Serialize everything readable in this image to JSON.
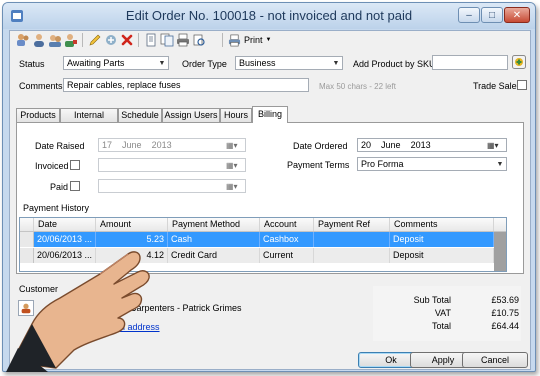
{
  "window": {
    "title": "Edit Order No. 100018 - not invoiced and not paid",
    "buttons": [
      "–",
      "□",
      "✕"
    ]
  },
  "toolbar": {
    "print_label": "Print",
    "icons": [
      "users-icon",
      "user-icon",
      "customers-icon",
      "edit-user-icon",
      "pencil-icon",
      "open-icon",
      "delete-icon",
      "document-icon",
      "copy-icon",
      "printer-icon",
      "print-icon"
    ]
  },
  "form": {
    "status_label": "Status",
    "status_value": "Awaiting Parts",
    "order_type_label": "Order Type",
    "order_type_value": "Business",
    "add_sku_label": "Add Product by SKU",
    "add_sku_value": "",
    "comments_label": "Comments",
    "comments_value": "Repair cables, replace fuses",
    "comments_hint": "Max 50 chars - 22 left",
    "trade_sale_label": "Trade Sale"
  },
  "tabs": [
    {
      "label": "Products"
    },
    {
      "label": "Internal Notes"
    },
    {
      "label": "Schedule"
    },
    {
      "label": "Assign Users"
    },
    {
      "label": "Hours"
    },
    {
      "label": "Billing"
    }
  ],
  "billing": {
    "date_raised_label": "Date Raised",
    "date_raised_day": "17",
    "date_raised_month": "June",
    "date_raised_year": "2013",
    "invoiced_label": "Invoiced",
    "paid_label": "Paid",
    "date_ordered_label": "Date Ordered",
    "date_ordered_day": "20",
    "date_ordered_month": "June",
    "date_ordered_year": "2013",
    "payment_terms_label": "Payment Terms",
    "payment_terms_value": "Pro Forma",
    "payment_history_label": "Payment History",
    "columns": [
      "Date",
      "Amount",
      "Payment Method",
      "Account",
      "Payment Ref",
      "Comments"
    ],
    "rows": [
      {
        "date": "20/06/2013 ...",
        "amount": "5.23",
        "method": "Cash",
        "account": "Cashbox",
        "ref": "",
        "comments": "Deposit"
      },
      {
        "date": "20/06/2013 ...",
        "amount": "4.12",
        "method": "Credit Card",
        "account": "Current",
        "ref": "",
        "comments": "Deposit"
      }
    ]
  },
  "customer": {
    "section_label": "Customer",
    "name_prefix": "C",
    "name_suffix": "ke Carpenters - Patrick Grimes",
    "email_link": "d email address"
  },
  "totals": {
    "subtotal_label": "Sub Total",
    "subtotal_value": "£53.69",
    "vat_label": "VAT",
    "vat_value": "£10.75",
    "total_label": "Total",
    "total_value": "£64.44"
  },
  "actions": {
    "ok": "Ok",
    "apply": "Apply",
    "cancel": "Cancel"
  },
  "colors": {
    "selection": "#3399ff",
    "link": "#0033cc",
    "title_text": "#1e395b"
  }
}
